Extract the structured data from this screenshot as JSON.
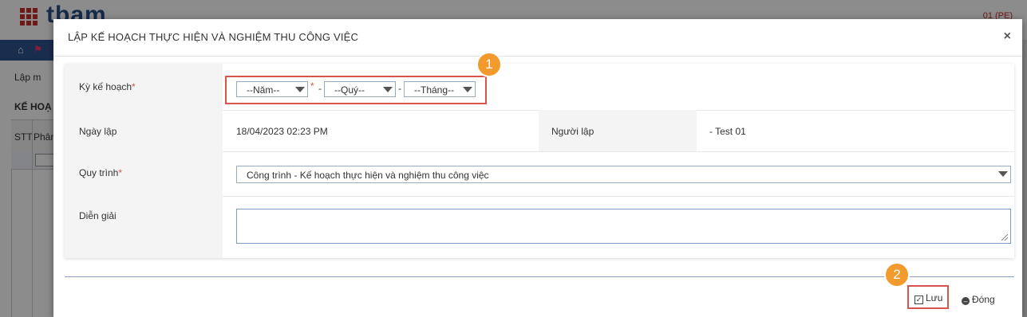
{
  "app": {
    "logo_text": "tbam",
    "top_right_text": "01 (PE)",
    "nav_home_icon": "home-icon",
    "toolbar_label": "Lập m",
    "section_title": "KẾ HOẠ",
    "grid_headers": [
      "STT",
      "Phân"
    ]
  },
  "modal": {
    "title": "LẬP KẾ HOẠCH THỰC HIỆN VÀ NGHIỆM THU CÔNG VIỆC",
    "close_label": "×",
    "fields": {
      "period_label": "Kỳ kế hoạch",
      "period_required": "*",
      "year_select": "--Năm--",
      "quarter_select": "--Quý--",
      "month_select": "--Tháng--",
      "separator": "-",
      "created_date_label": "Ngày lập",
      "created_date_value": "18/04/2023 02:23 PM",
      "creator_label": "Người lập",
      "creator_value": "- Test 01",
      "process_label": "Quy trình",
      "process_required": "*",
      "process_value": "Công trình - Kế hoạch thực hiện và nghiệm thu công việc",
      "description_label": "Diễn giải",
      "description_value": ""
    },
    "buttons": {
      "save_label": "Lưu",
      "close_label": "Đóng"
    },
    "annotations": {
      "badge1": "1",
      "badge2": "2"
    }
  },
  "colors": {
    "nav": "#2f5391",
    "highlight": "#d9534f",
    "badge": "#f39a2c"
  }
}
